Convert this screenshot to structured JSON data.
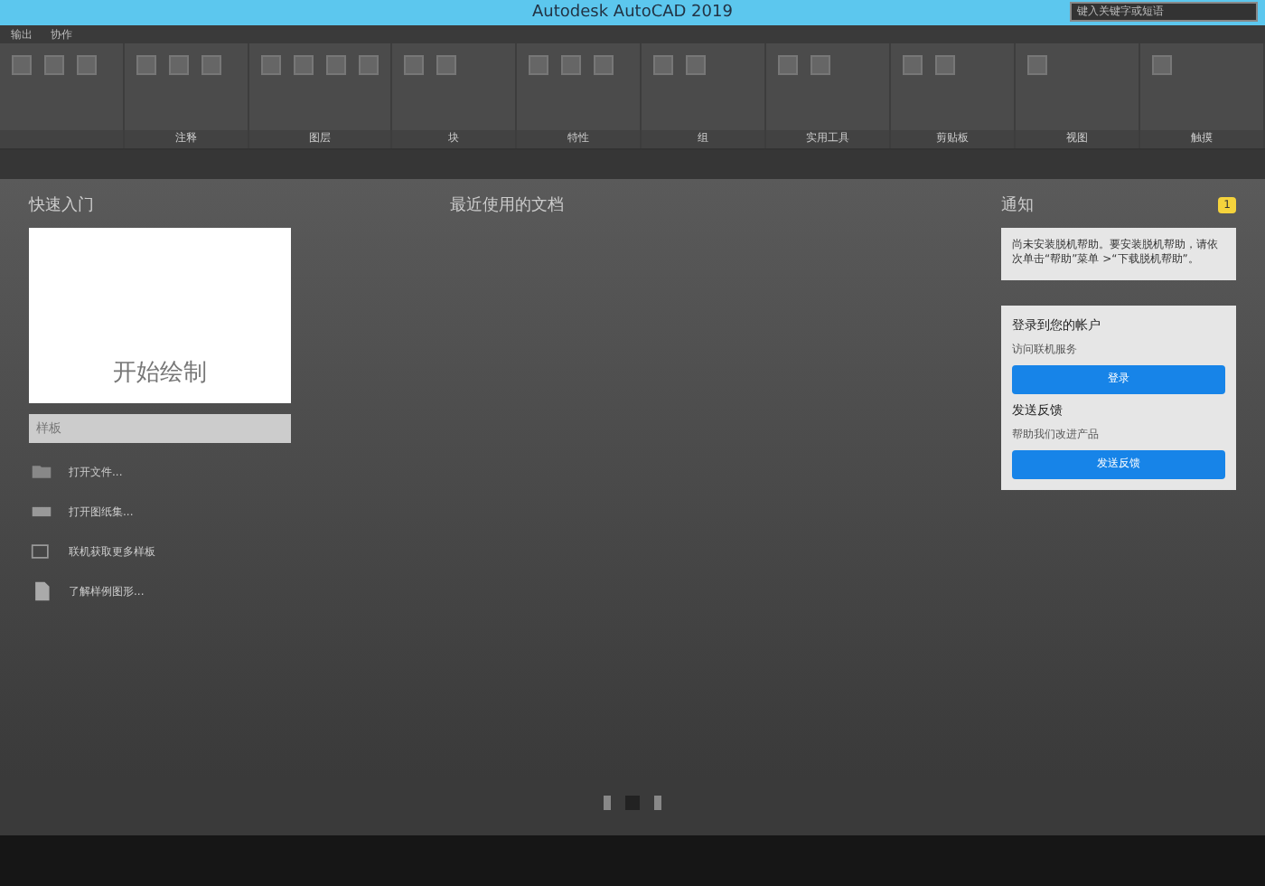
{
  "window": {
    "title": "Autodesk AutoCAD 2019",
    "search": {
      "placeholder": "键入关键字或短语"
    }
  },
  "menu": [
    "输出",
    "协作"
  ],
  "ribbon": {
    "panels": [
      {
        "label": "注释"
      },
      {
        "label": "图层"
      },
      {
        "label": "块"
      },
      {
        "label": "特性"
      },
      {
        "label": "组"
      },
      {
        "label": "实用工具"
      },
      {
        "label": "剪贴板"
      },
      {
        "label": "视图"
      },
      {
        "label": "触摸"
      }
    ]
  },
  "quick_start": {
    "heading": "快速入门",
    "card": {
      "label": "开始绘制",
      "template": "样板"
    },
    "links": [
      {
        "label": "打开文件...",
        "kind": "folder"
      },
      {
        "label": "打开图纸集...",
        "kind": "sheets"
      },
      {
        "label": "联机获取更多样板",
        "kind": "tray"
      },
      {
        "label": "了解样例图形...",
        "kind": "document"
      }
    ]
  },
  "recent": {
    "heading": "最近使用的文档"
  },
  "notifications": {
    "heading": "通知",
    "badge": "1",
    "help": {
      "text": "尚未安装脱机帮助。要安装脱机帮助，请依次单击“帮助”菜单 >“下载脱机帮助”。"
    },
    "account": {
      "title": "登录到您的帐户",
      "subtitle": "访问联机服务",
      "button": "登录"
    },
    "feedback": {
      "title": "发送反馈",
      "subtitle": "帮助我们改进产品",
      "button": "发送反馈"
    }
  },
  "pages": [
    {
      "selected": false
    },
    {
      "selected": true
    },
    {
      "selected": false
    }
  ]
}
